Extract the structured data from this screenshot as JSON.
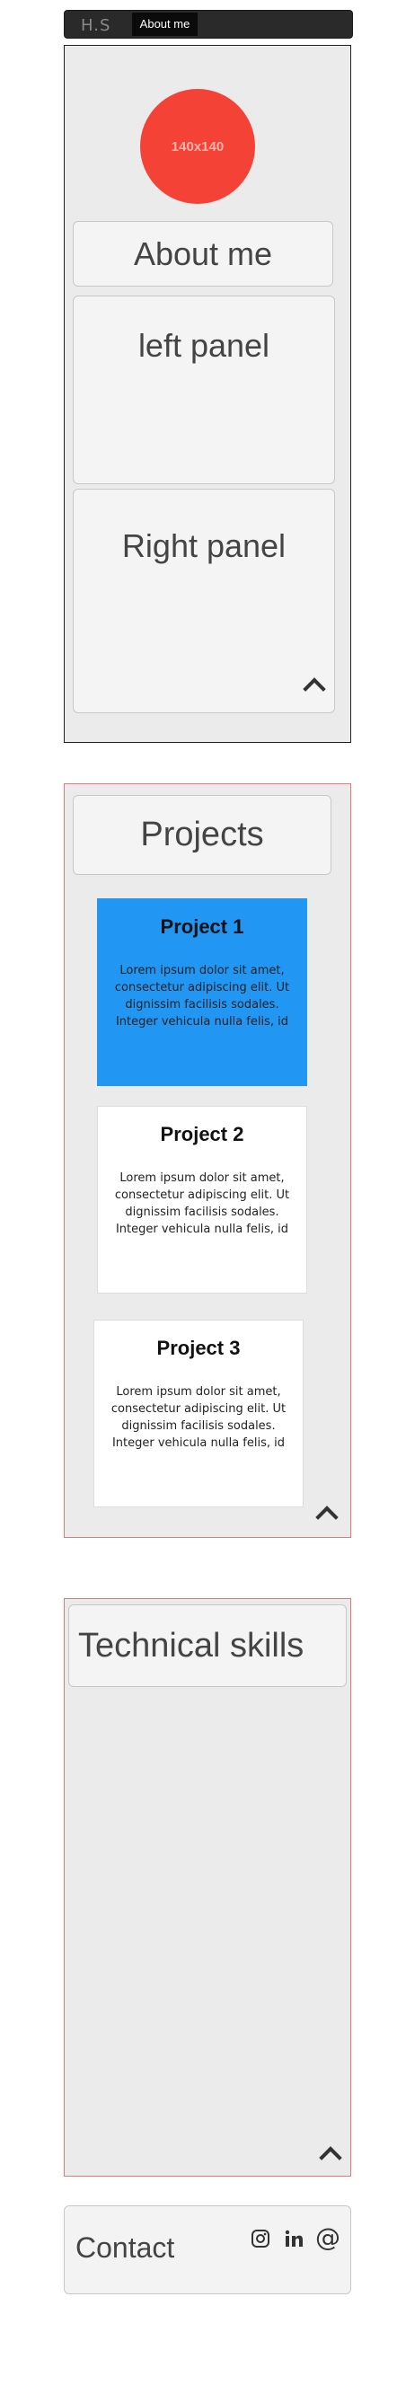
{
  "navbar": {
    "brand": "H.S",
    "active_item": "About me"
  },
  "about": {
    "avatar_text": "140x140",
    "title": "About me",
    "left_panel": "left panel",
    "right_panel": "Right panel"
  },
  "projects": {
    "title": "Projects",
    "cards": [
      {
        "title": "Project 1",
        "text": "Lorem ipsum dolor sit amet, consectetur adipiscing elit. Ut dignissim facilisis sodales. Integer vehicula nulla felis, id egest egestas lorem. Integer consequat."
      },
      {
        "title": "Project 2",
        "text": "Lorem ipsum dolor sit amet, consectetur adipiscing elit. Ut dignissim facilisis sodales. Integer vehicula nulla felis, id egest egestas lorem. Integer consequat."
      },
      {
        "title": "Project 3",
        "text": "Lorem ipsum dolor sit amet, consectetur adipiscing elit. Ut dignissim facilisis sodales. Integer vehicula nulla felis, id egest egestas lorem. Integer consequat."
      }
    ]
  },
  "skills": {
    "title": "Technical skills"
  },
  "contact": {
    "title": "Contact",
    "icons": [
      "instagram-icon",
      "linkedin-icon",
      "email-icon"
    ]
  },
  "colors": {
    "accent_red": "#f44336",
    "active_card": "#2196f3",
    "nav_bg": "#2a2a2a"
  }
}
